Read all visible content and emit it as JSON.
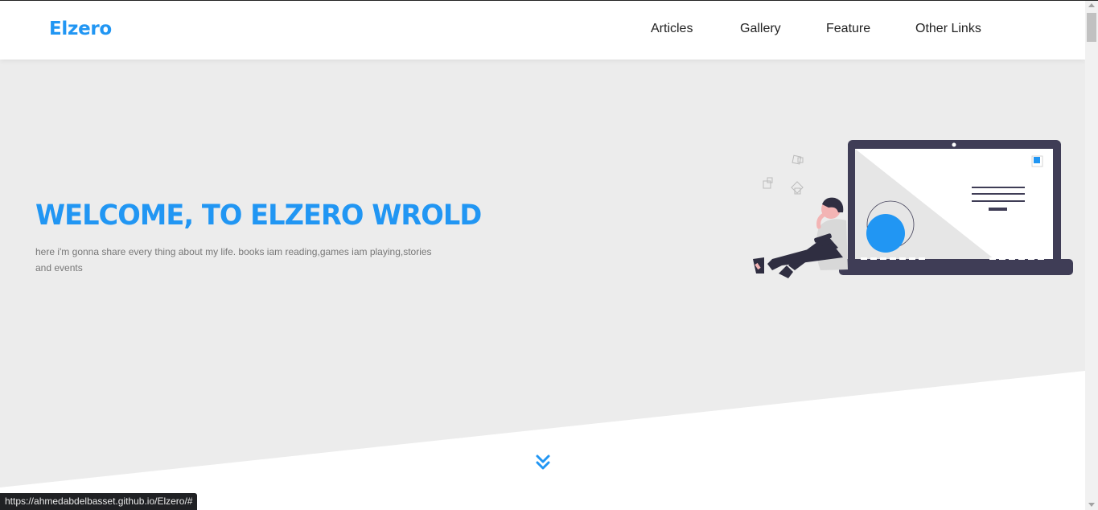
{
  "header": {
    "logo": "Elzero",
    "nav": [
      {
        "label": "Articles"
      },
      {
        "label": "Gallery"
      },
      {
        "label": "Feature"
      },
      {
        "label": "Other Links"
      }
    ]
  },
  "hero": {
    "title": "WELCOME, TO ELZERO WROLD",
    "description": "here i'm gonna share every thing about my life. books iam reading,games iam playing,stories and events"
  },
  "status_bar": {
    "url": "https://ahmedabdelbasset.github.io/Elzero/#"
  },
  "colors": {
    "accent": "#2196f3",
    "hero_bg": "#ececec",
    "laptop": "#3f3d56"
  },
  "icons": {
    "scroll_down": "double-chevron-down-icon"
  }
}
